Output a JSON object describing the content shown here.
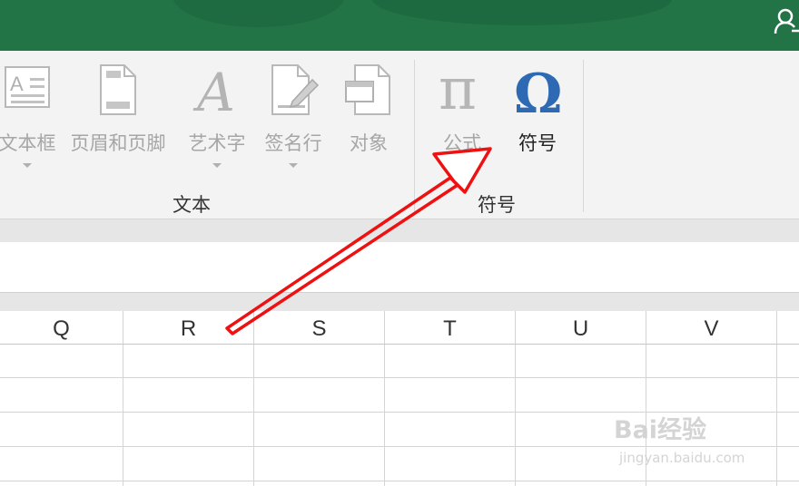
{
  "ribbon": {
    "buttons": [
      {
        "id": "textbox",
        "label": "文本框",
        "icon": "textbox-icon"
      },
      {
        "id": "header-footer",
        "label": "页眉和页脚",
        "icon": "header-footer-icon"
      },
      {
        "id": "wordart",
        "label": "艺术字",
        "icon": "wordart-icon"
      },
      {
        "id": "signature",
        "label": "签名行",
        "icon": "signature-line-icon"
      },
      {
        "id": "object",
        "label": "对象",
        "icon": "object-icon"
      },
      {
        "id": "equation",
        "label": "公式",
        "icon": "pi-icon"
      },
      {
        "id": "symbol",
        "label": "符号",
        "icon": "omega-icon"
      }
    ],
    "groups": {
      "text": "文本",
      "symbols": "符号"
    },
    "glyphs": {
      "wordart": "A",
      "equation": "π",
      "symbol": "Ω",
      "textbox": "A"
    }
  },
  "columns": [
    "Q",
    "R",
    "S",
    "T",
    "U",
    "V"
  ],
  "watermark": {
    "logo": "Bai经验",
    "url": "jingyan.baidu.com"
  },
  "colors": {
    "titlebar": "#227447",
    "ribbon": "#f3f3f3",
    "symbol_icon": "#2e6ab3",
    "arrow": "#ee1111"
  }
}
